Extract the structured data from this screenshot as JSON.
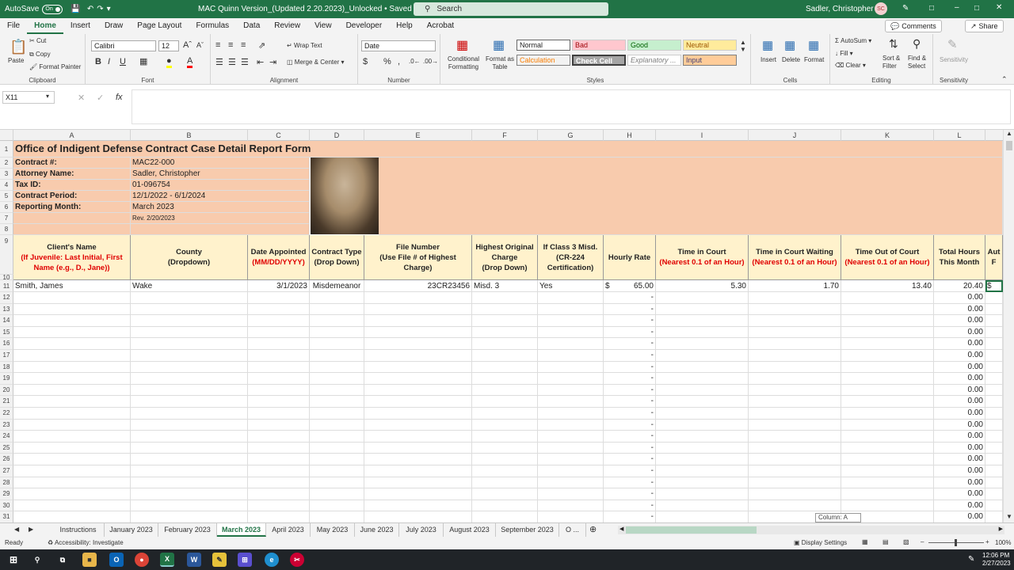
{
  "titlebar": {
    "autosave": "AutoSave",
    "toggle": "On",
    "doc_title": "MAC Quinn Version_(Updated 2.20.2023)_Unlocked • Saved",
    "search": "Search",
    "user": "Sadler, Christopher A.",
    "initials": "SC"
  },
  "menu": {
    "items": [
      "File",
      "Home",
      "Insert",
      "Draw",
      "Page Layout",
      "Formulas",
      "Data",
      "Review",
      "View",
      "Developer",
      "Help",
      "Acrobat"
    ],
    "comments": "Comments",
    "share": "Share"
  },
  "ribbon": {
    "clipboard": {
      "paste": "Paste",
      "cut": "Cut",
      "copy": "Copy",
      "format_painter": "Format Painter",
      "label": "Clipboard"
    },
    "font": {
      "name": "Calibri",
      "size": "12",
      "label": "Font"
    },
    "alignment": {
      "wrap": "Wrap Text",
      "merge": "Merge & Center",
      "label": "Alignment"
    },
    "number": {
      "format": "Date",
      "label": "Number"
    },
    "styles": {
      "conditional": "Conditional Formatting",
      "format_table": "Format as Table",
      "normal": "Normal",
      "bad": "Bad",
      "good": "Good",
      "neutral": "Neutral",
      "calculation": "Calculation",
      "check_cell": "Check Cell",
      "explanatory": "Explanatory ...",
      "input": "Input",
      "label": "Styles"
    },
    "cells": {
      "insert": "Insert",
      "delete": "Delete",
      "format": "Format",
      "label": "Cells"
    },
    "editing": {
      "autosum": "AutoSum",
      "fill": "Fill",
      "clear": "Clear",
      "sort": "Sort & Filter",
      "find": "Find & Select",
      "label": "Editing"
    },
    "sensitivity": {
      "label": "Sensitivity"
    }
  },
  "namebox": "X11",
  "columns": [
    "A",
    "B",
    "C",
    "D",
    "E",
    "F",
    "G",
    "H",
    "I",
    "J",
    "K",
    "L"
  ],
  "sheet": {
    "title": "Office of Indigent Defense Contract Case Detail Report Form",
    "info": [
      {
        "label": "Contract #:",
        "value": "MAC22-000"
      },
      {
        "label": "Attorney Name:",
        "value": "Sadler, Christopher"
      },
      {
        "label": "Tax ID:",
        "value": "01-096754"
      },
      {
        "label": "Contract Period:",
        "value": "12/1/2022 - 6/1/2024"
      },
      {
        "label": "Reporting Month:",
        "value": "March 2023"
      },
      {
        "label": "",
        "value": "Rev. 2/20/2023"
      }
    ],
    "headers": [
      {
        "l1": "Client's Name",
        "red": "(If Juvenile: Last Initial, First Name (e.g., D., Jane))"
      },
      {
        "l1": "County",
        "l2": "(Dropdown)"
      },
      {
        "l1": "Date Appointed",
        "red": "(MM/DD/YYYY)"
      },
      {
        "l1": "Contract Type",
        "l2": "(Drop Down)"
      },
      {
        "l1": "File Number",
        "l2": "(Use File # of Highest Charge)"
      },
      {
        "l1": "Highest Original Charge",
        "l2": "(Drop Down)"
      },
      {
        "l1": "If Class 3 Misd.",
        "l2": "(CR-224 Certification)"
      },
      {
        "l1": "Hourly Rate"
      },
      {
        "l1": "Time in Court",
        "red": "(Nearest 0.1 of an Hour)"
      },
      {
        "l1": "Time in Court Waiting",
        "red": "(Nearest 0.1 of an Hour)"
      },
      {
        "l1": "Time Out of Court",
        "red": "(Nearest 0.1 of an Hour)"
      },
      {
        "l1": "Total Hours This Month"
      },
      {
        "l1": "Aut F"
      }
    ],
    "row11": [
      "Smith, James",
      "Wake",
      "3/1/2023",
      "Misdemeanor",
      "23CR23456",
      "Misd. 3",
      "Yes",
      "$",
      "65.00",
      "5.30",
      "1.70",
      "13.40",
      "20.40",
      "$"
    ],
    "dash": "-",
    "zero": "0.00"
  },
  "tabs": [
    "Instructions",
    "January 2023",
    "February 2023",
    "March 2023",
    "April 2023",
    "May 2023",
    "June 2023",
    "July 2023",
    "August 2023",
    "September 2023",
    "O ..."
  ],
  "tooltip": "Column: A",
  "status": {
    "ready": "Ready",
    "accessibility": "Accessibility: Investigate",
    "display": "Display Settings",
    "zoom": "100%"
  },
  "taskbar": {
    "time": "12:06 PM",
    "date": "2/27/2023"
  }
}
